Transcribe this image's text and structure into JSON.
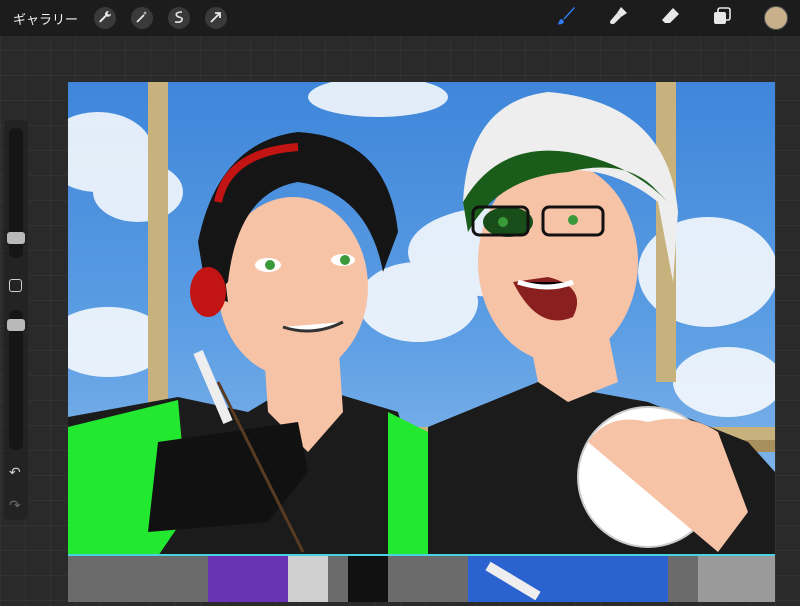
{
  "toolbar": {
    "gallery_label": "ギャラリー",
    "left_tools": [
      {
        "icon": "wrench-icon"
      },
      {
        "icon": "magic-wand-icon"
      },
      {
        "icon": "selection-icon"
      },
      {
        "icon": "transform-arrow-icon"
      }
    ],
    "right_tools": [
      {
        "icon": "brush-icon",
        "active_color": "#2f7cf6"
      },
      {
        "icon": "smudge-icon"
      },
      {
        "icon": "eraser-icon"
      },
      {
        "icon": "layers-icon"
      }
    ],
    "current_color": "#c7b08a"
  },
  "sidebar": {
    "brush_size_level": 0.3,
    "opacity_level": 0.35
  }
}
